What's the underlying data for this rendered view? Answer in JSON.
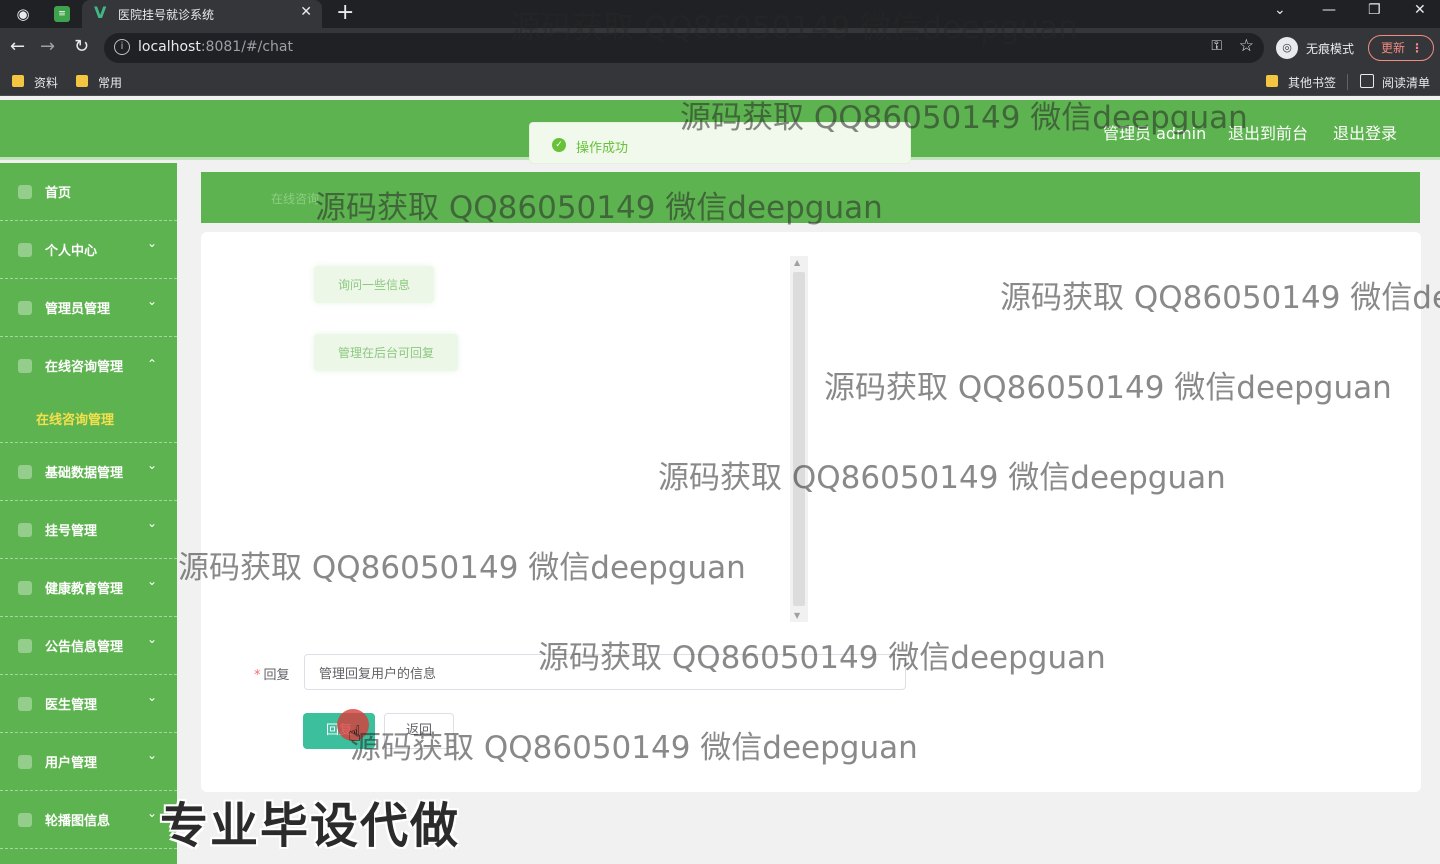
{
  "browser": {
    "tab_title": "医院挂号就诊系统",
    "url_host": "localhost",
    "url_path": ":8081/#/chat",
    "incognito_label": "无痕模式",
    "update_label": "更新",
    "bookmarks": [
      "资料",
      "常用"
    ],
    "bookmarks_right": [
      "其他书签",
      "阅读清单"
    ]
  },
  "header": {
    "user": "管理员 admin",
    "to_front": "退出到前台",
    "logout": "退出登录"
  },
  "toast": {
    "text": "操作成功",
    "color": "#67c23a"
  },
  "sidebar": {
    "items": [
      {
        "label": "首页",
        "icon": "home-icon",
        "has_arrow": false
      },
      {
        "label": "个人中心",
        "icon": "user-icon",
        "has_arrow": true
      },
      {
        "label": "管理员管理",
        "icon": "admin-icon",
        "has_arrow": true
      },
      {
        "label": "在线咨询管理",
        "icon": "chat-icon",
        "has_arrow": true,
        "expanded": true
      },
      {
        "label": "基础数据管理",
        "icon": "data-icon",
        "has_arrow": true
      },
      {
        "label": "挂号管理",
        "icon": "register-icon",
        "has_arrow": true
      },
      {
        "label": "健康教育管理",
        "icon": "health-icon",
        "has_arrow": true
      },
      {
        "label": "公告信息管理",
        "icon": "notice-icon",
        "has_arrow": true
      },
      {
        "label": "医生管理",
        "icon": "doctor-icon",
        "has_arrow": true
      },
      {
        "label": "用户管理",
        "icon": "users-icon",
        "has_arrow": true
      },
      {
        "label": "轮播图信息",
        "icon": "carousel-icon",
        "has_arrow": true
      }
    ],
    "subitem": "在线咨询管理",
    "accent": "#5db34f"
  },
  "breadcrumb": "在线咨询",
  "chat": {
    "messages": [
      "询问一些信息",
      "管理在后台可回复"
    ]
  },
  "form": {
    "reply_label": "回复",
    "reply_value": "管理回复用户的信息",
    "reply_button": "回复",
    "back_button": "返回"
  },
  "watermark": "源码获取 QQ86050149 微信deepguan",
  "brand_mark": "专业毕设代做"
}
